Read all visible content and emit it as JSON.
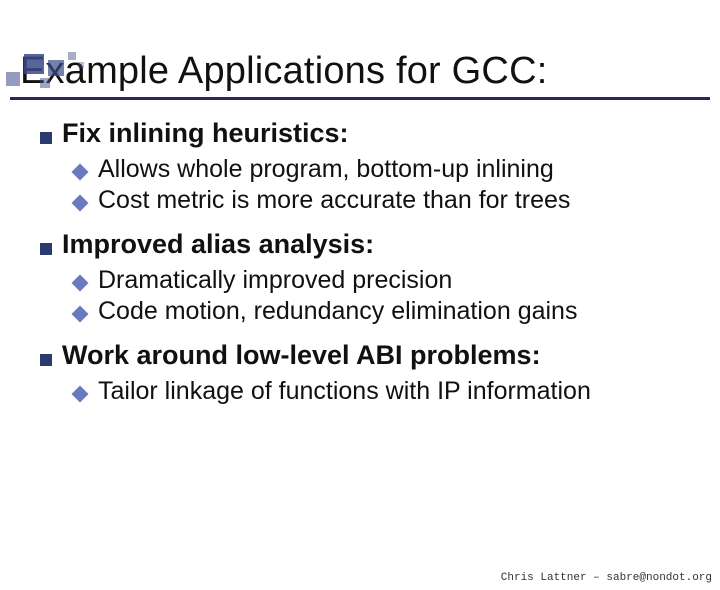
{
  "title": "Example Applications for GCC:",
  "sections": [
    {
      "heading": "Fix inlining heuristics:",
      "items": [
        "Allows whole program, bottom-up inlining",
        "Cost metric is more accurate than for trees"
      ]
    },
    {
      "heading": "Improved alias analysis:",
      "items": [
        "Dramatically improved precision",
        "Code motion, redundancy elimination gains"
      ]
    },
    {
      "heading": "Work around low-level ABI problems:",
      "items": [
        "Tailor linkage of functions with IP information"
      ]
    }
  ],
  "footer": "Chris Lattner – sabre@nondot.org"
}
